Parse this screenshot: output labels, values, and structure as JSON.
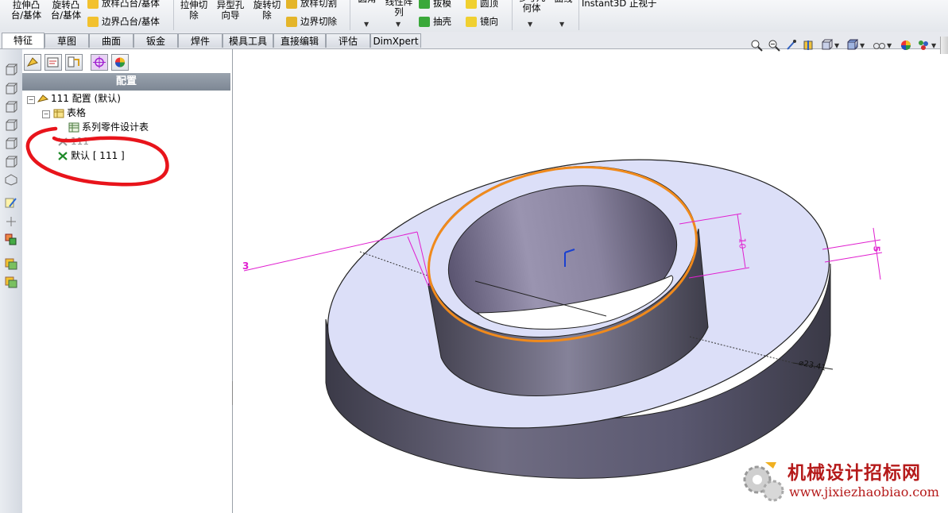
{
  "ribbon": {
    "extrude_boss": "拉伸凸\n台/基体",
    "revolve_boss": "旋转凸\n台/基体",
    "loft_boss": "放样凸台/基体",
    "boundary_boss": "边界凸台/基体",
    "extrude_cut": "拉伸切\n除",
    "hole_wizard": "异型孔\n向导",
    "revolve_cut": "旋转切\n除",
    "loft_cut": "放样切割",
    "boundary_cut": "边界切除",
    "fillet": "圆角",
    "linear_pattern": "线性阵\n列",
    "draft": "拔模",
    "shell": "抽壳",
    "dome": "圆顶",
    "mirror": "镜向",
    "ref_geometry": "参考几\n何体",
    "curves": "曲线",
    "instant3d": "Instant3D",
    "normal_to": "正视于"
  },
  "tabs": [
    "特征",
    "草图",
    "曲面",
    "钣金",
    "焊件",
    "模具工具",
    "直接编辑",
    "评估",
    "DimXpert"
  ],
  "feature_manager": {
    "header": "配置",
    "root_label": "111 配置  (默认)",
    "tables_label": "表格",
    "design_table_label": "系列零件设计表",
    "config_111": "111",
    "config_default": "默认 [ 111 ]"
  },
  "dimensions": {
    "d3": "3",
    "d10": "10",
    "d5": "5",
    "ddiam": "⌀23.41"
  },
  "watermark": {
    "cn": "机械设计招标网",
    "url": "www.jixiezhaobiao.com"
  },
  "colors": {
    "annotation_red": "#e8141b",
    "edge_orange": "#f08a1c",
    "dimension_magenta": "#e020d0",
    "part_face": "#dcdff8"
  }
}
